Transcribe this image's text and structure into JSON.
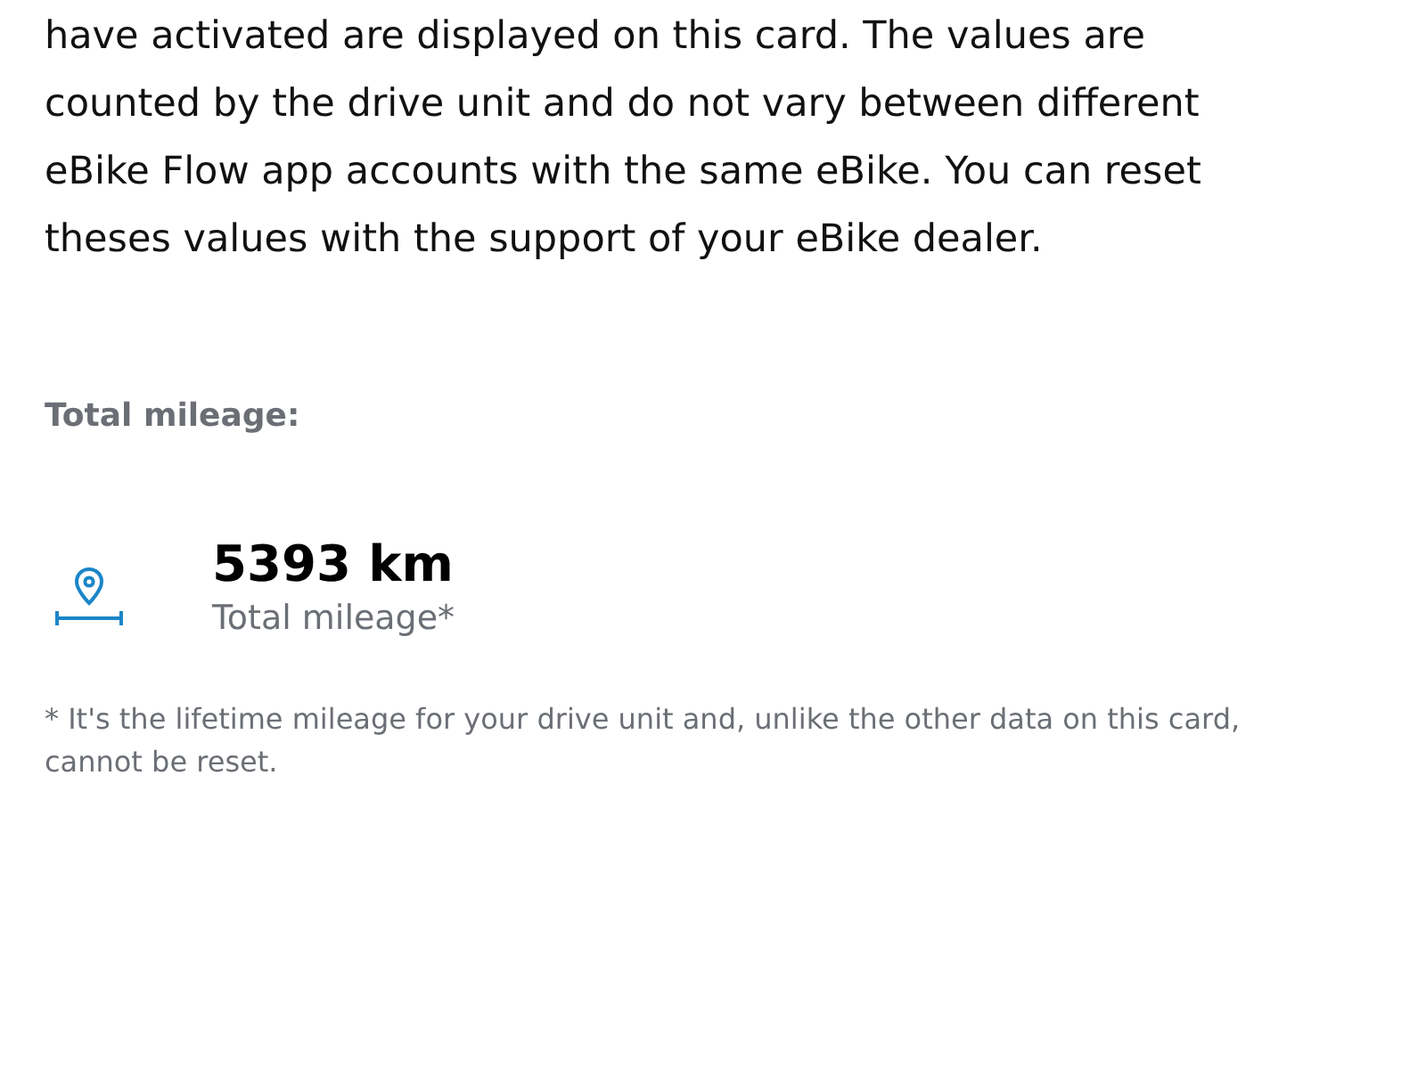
{
  "description": {
    "lines": [
      "have activated are displayed on this card. The values are",
      "counted by the drive unit and do not vary between different",
      "eBike Flow app accounts with the same eBike. You can reset",
      "theses values with the support of your eBike dealer."
    ]
  },
  "section": {
    "heading": "Total mileage:",
    "stats": [
      {
        "kind": "distance",
        "value": "5393 km",
        "label": "Total mileage*"
      }
    ]
  },
  "footnote": {
    "lines": [
      "* It's the lifetime mileage for your drive unit and, unlike the other data on this card,",
      "cannot be reset."
    ]
  }
}
